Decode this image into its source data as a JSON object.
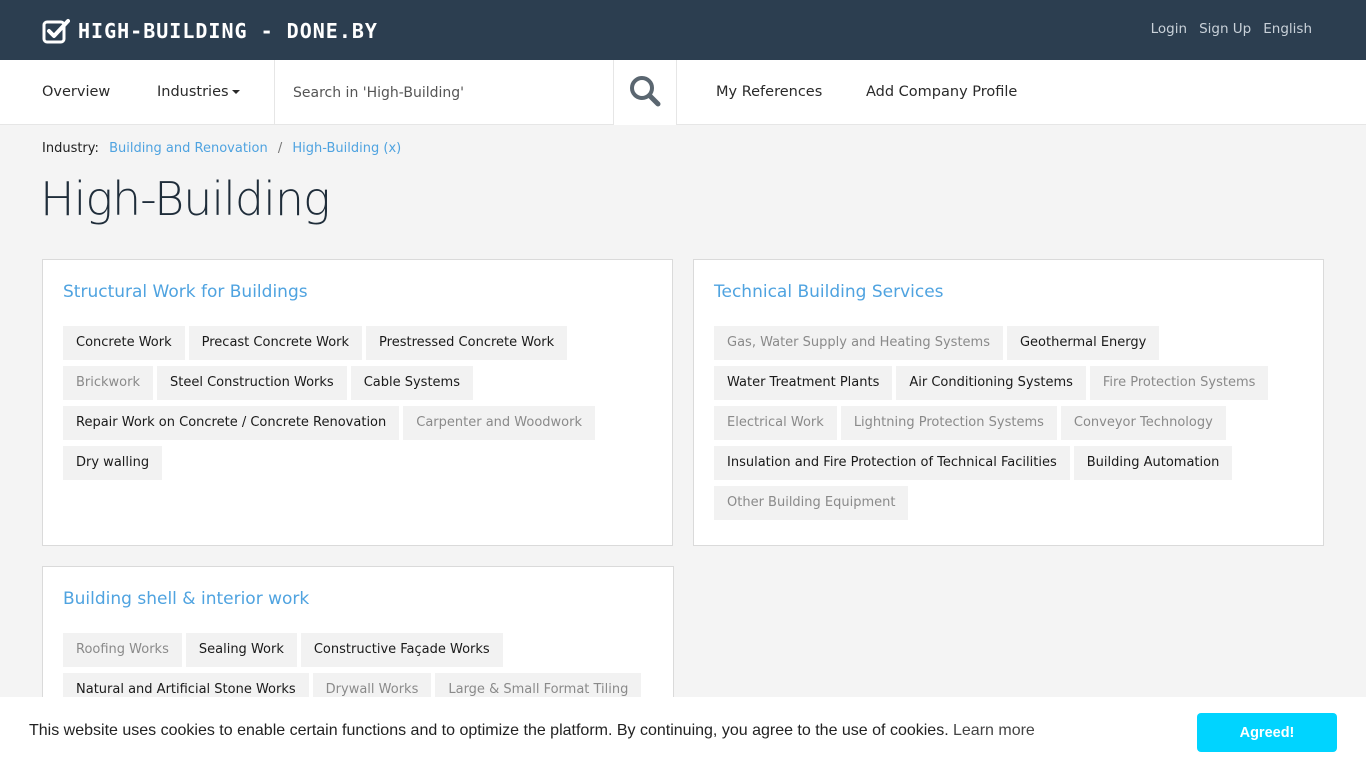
{
  "header": {
    "brand": "HIGH-BUILDING - DONE.BY",
    "links": [
      "Login",
      "Sign Up",
      "English"
    ]
  },
  "nav": {
    "overview": "Overview",
    "industries": "Industries",
    "search_placeholder": "Search in 'High-Building'",
    "my_references": "My References",
    "add_company": "Add Company Profile"
  },
  "breadcrumb": {
    "label": "Industry:",
    "items": [
      "Building and Renovation",
      "High-Building (x)"
    ],
    "separator": "/"
  },
  "page_title": "High-Building",
  "cards": [
    {
      "title": "Structural Work for Buildings",
      "tags": [
        {
          "label": "Concrete Work",
          "muted": false
        },
        {
          "label": "Precast Concrete Work",
          "muted": false
        },
        {
          "label": "Prestressed Concrete Work",
          "muted": false
        },
        {
          "label": "Brickwork",
          "muted": true
        },
        {
          "label": "Steel Construction Works",
          "muted": false
        },
        {
          "label": "Cable Systems",
          "muted": false
        },
        {
          "label": "Repair Work on Concrete / Concrete Renovation",
          "muted": false
        },
        {
          "label": "Carpenter and Woodwork",
          "muted": true
        },
        {
          "label": "Dry walling",
          "muted": false
        }
      ]
    },
    {
      "title": "Technical Building Services",
      "tags": [
        {
          "label": "Gas, Water Supply and Heating Systems",
          "muted": true
        },
        {
          "label": "Geothermal Energy",
          "muted": false
        },
        {
          "label": "Water Treatment Plants",
          "muted": false
        },
        {
          "label": "Air Conditioning Systems",
          "muted": false
        },
        {
          "label": "Fire Protection Systems",
          "muted": true
        },
        {
          "label": "Electrical Work",
          "muted": true
        },
        {
          "label": "Lightning Protection Systems",
          "muted": true
        },
        {
          "label": "Conveyor Technology",
          "muted": true
        },
        {
          "label": "Insulation and Fire Protection of Technical Facilities",
          "muted": false
        },
        {
          "label": "Building Automation",
          "muted": false
        },
        {
          "label": "Other Building Equipment",
          "muted": true
        }
      ]
    },
    {
      "title": "Building shell & interior work",
      "tags": [
        {
          "label": "Roofing Works",
          "muted": true
        },
        {
          "label": "Sealing Work",
          "muted": false
        },
        {
          "label": "Constructive Façade Works",
          "muted": false
        },
        {
          "label": "Natural and Artificial Stone Works",
          "muted": false
        },
        {
          "label": "Drywall Works",
          "muted": true
        },
        {
          "label": "Large & Small Format Tiling",
          "muted": true
        }
      ]
    }
  ],
  "cookie": {
    "text": "This website uses cookies to enable certain functions and to optimize the platform. By continuing, you agree to the use of cookies.",
    "learn_more": "Learn more",
    "button": "Agreed!"
  },
  "colors": {
    "header_bg": "#2c3e50",
    "link_blue": "#4fa3e0",
    "cookie_button": "#00d4ff",
    "page_bg": "#f4f4f4"
  },
  "icons": {
    "brand": "check-square-icon",
    "search": "search-icon"
  }
}
